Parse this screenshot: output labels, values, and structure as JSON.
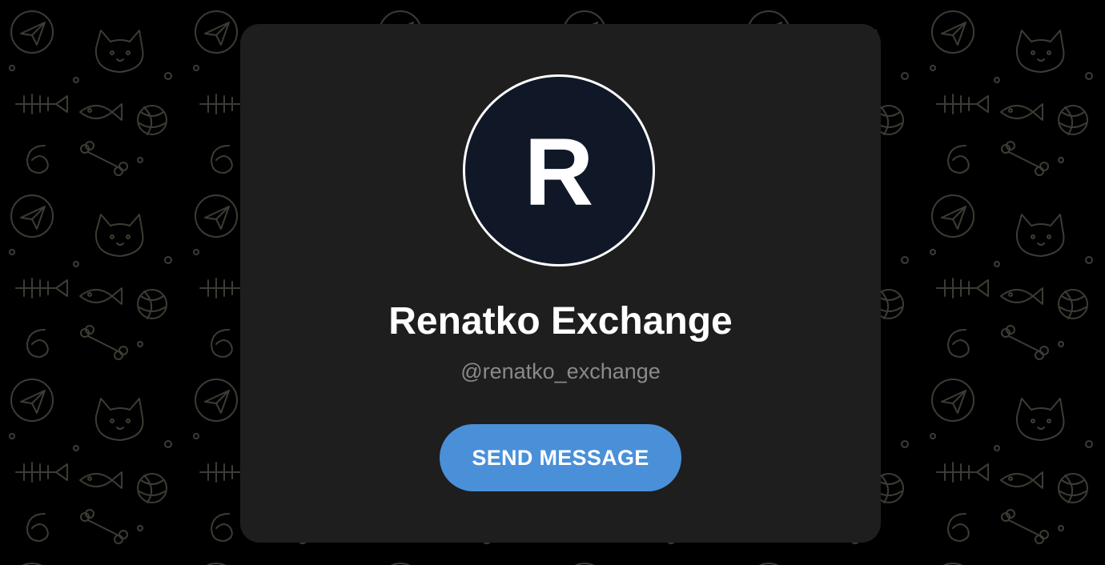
{
  "profile": {
    "avatar_letter": "R",
    "name": "Renatko Exchange",
    "username": "@renatko_exchange"
  },
  "actions": {
    "send_message_label": "SEND MESSAGE"
  },
  "colors": {
    "background": "#000000",
    "card": "#1e1e1e",
    "avatar_fill": "#101828",
    "button": "#4a90d9",
    "handle_text": "#8a8a8a",
    "doodle_stroke": "#3a3d33"
  },
  "icons": {
    "background_pattern": "doodle-pattern-icon"
  }
}
